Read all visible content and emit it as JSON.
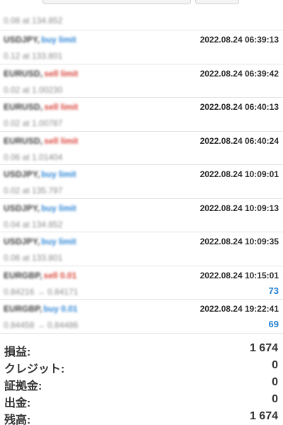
{
  "partial_row": {
    "detail": "0.08 at 134.852"
  },
  "orders": [
    {
      "symbol": "USDJPY,",
      "type": "buy limit",
      "kind": "buy",
      "detail": "0.12 at 133.801",
      "time": "2022.08.24 06:39:13",
      "profit": ""
    },
    {
      "symbol": "EURUSD,",
      "type": "sell limit",
      "kind": "sell",
      "detail": "0.02 at 1.00230",
      "time": "2022.08.24 06:39:42",
      "profit": ""
    },
    {
      "symbol": "EURUSD,",
      "type": "sell limit",
      "kind": "sell",
      "detail": "0.02 at 1.00787",
      "time": "2022.08.24 06:40:13",
      "profit": ""
    },
    {
      "symbol": "EURUSD,",
      "type": "sell limit",
      "kind": "sell",
      "detail": "0.06 at 1.01404",
      "time": "2022.08.24 06:40:24",
      "profit": ""
    },
    {
      "symbol": "USDJPY,",
      "type": "buy limit",
      "kind": "buy",
      "detail": "0.02 at 135.797",
      "time": "2022.08.24 10:09:01",
      "profit": ""
    },
    {
      "symbol": "USDJPY,",
      "type": "buy limit",
      "kind": "buy",
      "detail": "0.04 at 134.852",
      "time": "2022.08.24 10:09:13",
      "profit": ""
    },
    {
      "symbol": "USDJPY,",
      "type": "buy limit",
      "kind": "buy",
      "detail": "0.06 at 133.801",
      "time": "2022.08.24 10:09:35",
      "profit": ""
    },
    {
      "symbol": "EURGBP,",
      "type": "sell 0.01",
      "kind": "sell",
      "detail": "0.84216 → 0.84171",
      "time": "2022.08.24 10:15:01",
      "profit": "73"
    },
    {
      "symbol": "EURGBP,",
      "type": "buy 0.01",
      "kind": "buy",
      "detail": "0.84458 → 0.84486",
      "time": "2022.08.24 19:22:41",
      "profit": "69"
    }
  ],
  "summary": [
    {
      "label": "損益:",
      "value": "1 674"
    },
    {
      "label": "クレジット:",
      "value": "0"
    },
    {
      "label": "証拠金:",
      "value": "0"
    },
    {
      "label": "出金:",
      "value": "0"
    },
    {
      "label": "残高:",
      "value": "1 674"
    }
  ],
  "colors": {
    "buy": "#2f86d6",
    "sell": "#d9443a",
    "profit": "#1e7fd0"
  }
}
